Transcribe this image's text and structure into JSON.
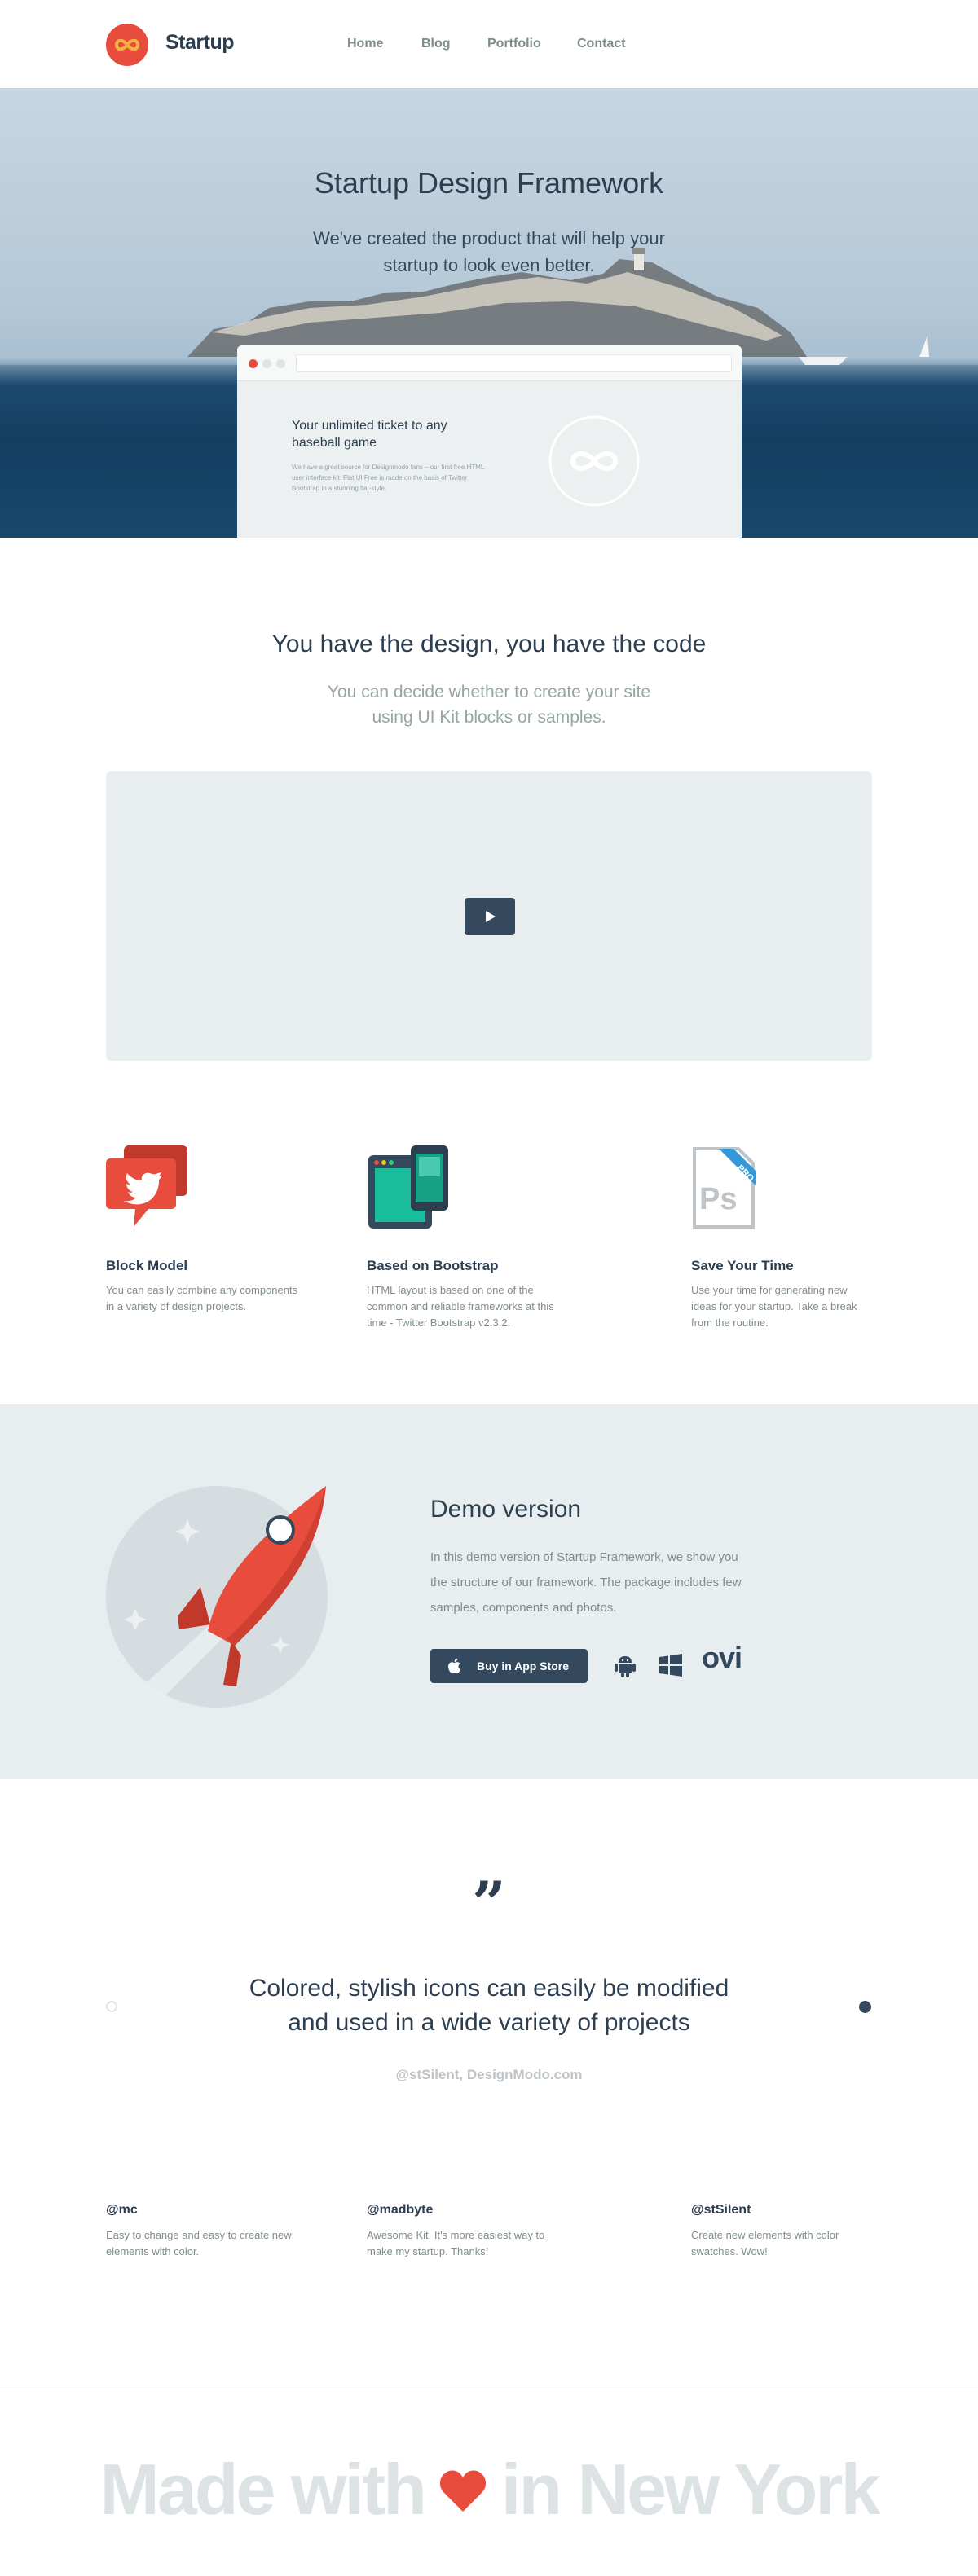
{
  "header": {
    "brand": "Startup",
    "nav": [
      "Home",
      "Blog",
      "Portfolio",
      "Contact"
    ]
  },
  "hero": {
    "title": "Startup Design Framework",
    "subtitle": "We've created the product that will help your startup to look even better.",
    "mockup": {
      "title": "Your unlimited ticket to any baseball game",
      "text": "We have a great source for Designmodo fans – our first free HTML user interface kit. Flat UI Free is made on the basis of Twitter Bootstrap in a stunning flat-style."
    }
  },
  "intro": {
    "title": "You have the design, you have the code",
    "subtitle": "You can decide whether to create your site using UI Kit blocks or samples."
  },
  "features": [
    {
      "icon": "twitter-bubble-icon",
      "title": "Block Model",
      "text": "You can easily combine any components in a variety of design projects."
    },
    {
      "icon": "bootstrap-devices-icon",
      "title": "Based on Bootstrap",
      "text": "HTML layout is based on one of the common and reliable frameworks at this time - Twitter Bootstrap v2.3.2."
    },
    {
      "icon": "psd-pro-icon",
      "title": "Save Your Time",
      "text": "Use your time for generating new ideas for your startup. Take a break from the routine.",
      "badge": "PRO",
      "file_label": "Ps"
    }
  ],
  "demo": {
    "title": "Demo version",
    "text": "In this demo version of Startup Framework, we show you the structure of our framework. The package includes few samples, components and photos.",
    "app_store_label": "Buy in App Store",
    "platforms": [
      "apple-icon",
      "android-icon",
      "windows-icon",
      "ovi-logo"
    ],
    "ovi_label": "ovi"
  },
  "quote": {
    "mark": "”",
    "text": "Colored, stylish icons can easily be modified and used in a wide variety of projects",
    "author": "@stSilent, DesignModo.com"
  },
  "testimonials": [
    {
      "handle": "@mc",
      "text": "Easy to change and easy to create new elements with color."
    },
    {
      "handle": "@madbyte",
      "text": "Awesome Kit. It's more easiest way to make my startup. Thanks!"
    },
    {
      "handle": "@stSilent",
      "text": "Create new elements with color swatches. Wow!"
    }
  ],
  "footer": {
    "made_with": "Made with",
    "in_city": "in New York"
  },
  "colors": {
    "accent": "#e74c3c",
    "dark": "#2c3e50",
    "muted": "#7f8c8d",
    "panel": "#e8eef0",
    "orange": "#f39c12"
  }
}
